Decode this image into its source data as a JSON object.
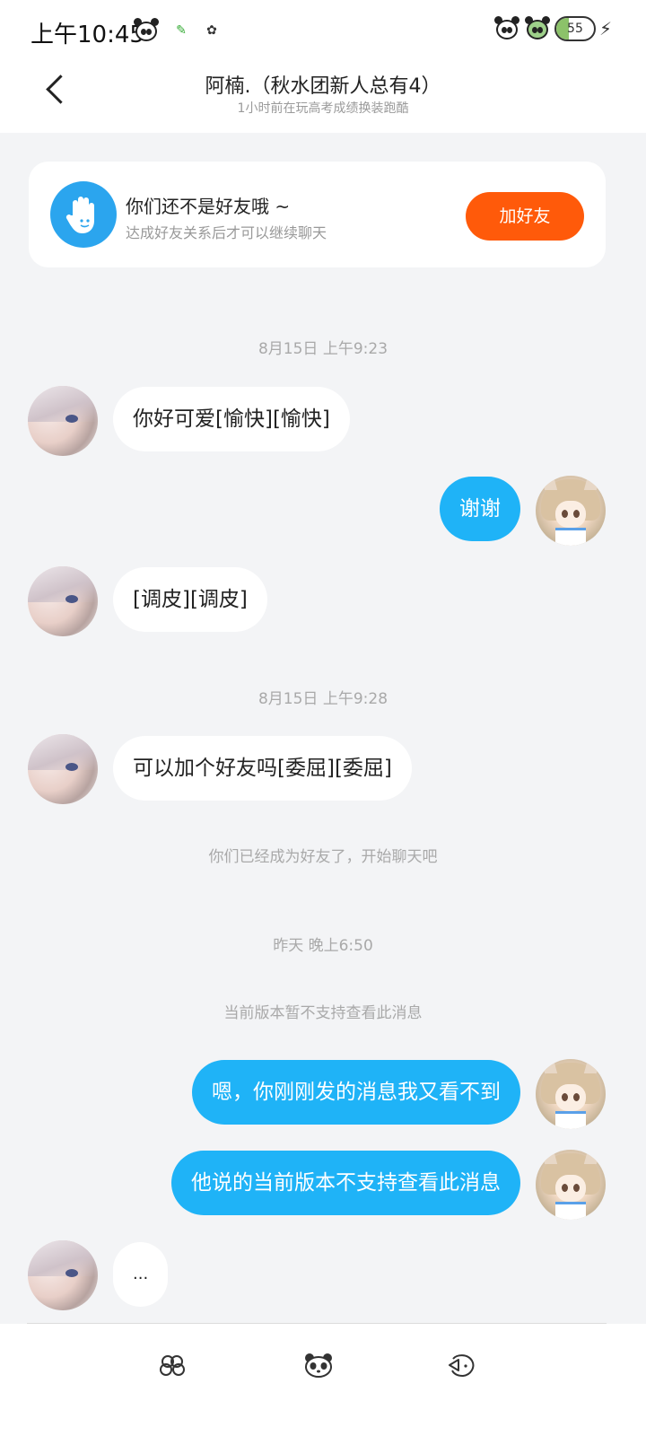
{
  "status_bar": {
    "time": "上午10:45",
    "battery_level": "55"
  },
  "header": {
    "title": "阿楠.（秋水团新人总有4）",
    "subtitle": "1小时前在玩高考成绩换装跑酷"
  },
  "friend_banner": {
    "title": "你们还不是好友哦 ~",
    "subtitle": "达成好友关系后才可以继续聊天",
    "add_button": "加好友"
  },
  "chat": {
    "timestamp_1": "8月15日 上午9:23",
    "msg_1": "你好可爱[愉快][愉快]",
    "msg_2": "谢谢",
    "msg_3": "[调皮][调皮]",
    "timestamp_2": "8月15日 上午9:28",
    "msg_4": "可以加个好友吗[委屈][委屈]",
    "system_1": "你们已经成为好友了，开始聊天吧",
    "timestamp_3": "昨天 晚上6:50",
    "system_2": "当前版本暂不支持查看此消息",
    "msg_5": "嗯，你刚刚发的消息我又看不到",
    "msg_6": "他说的当前版本不支持查看此消息",
    "msg_7": "..."
  },
  "bottom_bar": {
    "icons": [
      "stickers-icon",
      "panda-emoji-icon",
      "recall-icon"
    ]
  }
}
